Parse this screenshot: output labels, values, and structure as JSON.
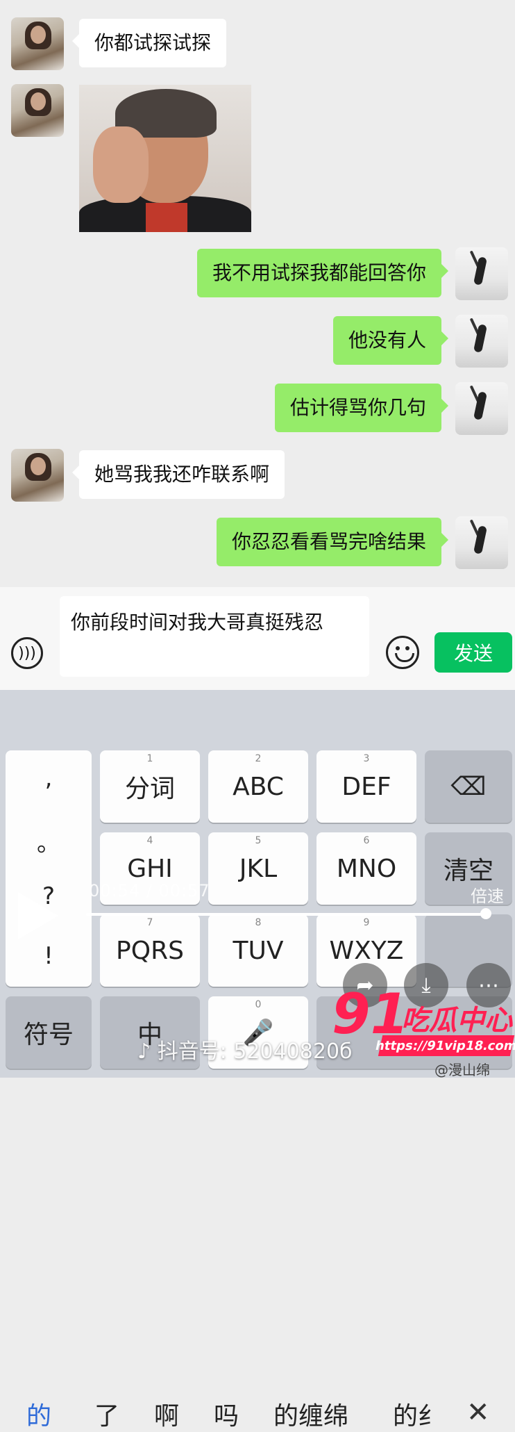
{
  "messages": [
    {
      "side": "left",
      "type": "text",
      "text": "你都试探试探"
    },
    {
      "side": "left",
      "type": "sticker",
      "sticker_name": "man-scratching-head-sticker"
    },
    {
      "side": "right",
      "type": "text",
      "text": "我不用试探我都能回答你"
    },
    {
      "side": "right",
      "type": "text",
      "text": "他没有人"
    },
    {
      "side": "right",
      "type": "text",
      "text": "估计得骂你几句"
    },
    {
      "side": "left",
      "type": "text",
      "text": "她骂我我还咋联系啊"
    },
    {
      "side": "right",
      "type": "text",
      "text": "你忍忍看看骂完啥结果"
    }
  ],
  "input": {
    "value": "你前段时间对我大哥真挺残忍",
    "send_label": "发送",
    "voice_icon": "voice-icon",
    "emoji_icon": "emoji-icon"
  },
  "keyboard": {
    "candidates": [
      "的",
      "了",
      "啊",
      "吗",
      "的缠绵",
      "的纟"
    ],
    "punctuation": [
      ",",
      "。",
      "?",
      "!"
    ],
    "keys": [
      {
        "num": "1",
        "label": "分词"
      },
      {
        "num": "2",
        "label": "ABC"
      },
      {
        "num": "3",
        "label": "DEF"
      },
      {
        "num": "4",
        "label": "GHI"
      },
      {
        "num": "5",
        "label": "JKL"
      },
      {
        "num": "6",
        "label": "MNO"
      },
      {
        "num": "7",
        "label": "PQRS"
      },
      {
        "num": "8",
        "label": "TUV"
      },
      {
        "num": "9",
        "label": "WXYZ"
      }
    ],
    "clear_label": "清空",
    "symbols_label": "符号",
    "chinese_label": "中",
    "zero_num": "0"
  },
  "video": {
    "time": "00:54 / 00:57",
    "speed_label": "倍速",
    "progress": 0.99,
    "tiktok_id": "抖音号: 52040820б"
  },
  "watermark": {
    "logo_number": "91",
    "logo_text": "吃瓜中心",
    "url": "https://91vip18.com",
    "weibo": "@漫山绵"
  },
  "colors": {
    "chat_bg": "#ededed",
    "bubble_right": "#95ec69",
    "bubble_left": "#ffffff",
    "send_green": "#07c160",
    "candidate_blue": "#2f6bd8",
    "logo_red": "#ff2052"
  }
}
